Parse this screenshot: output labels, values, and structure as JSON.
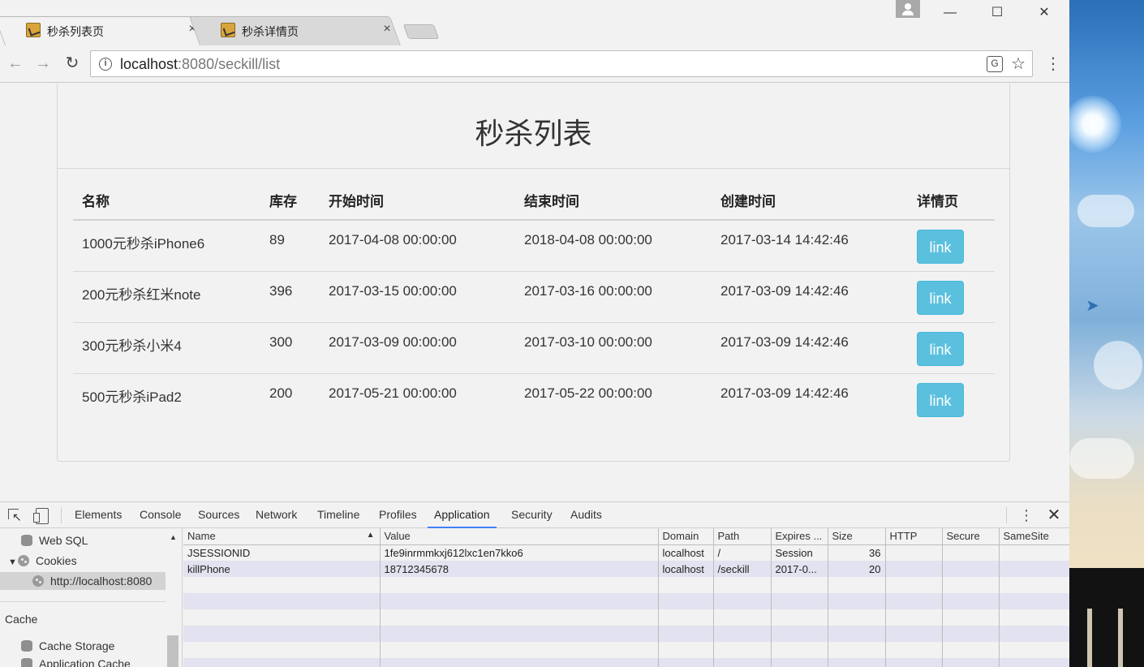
{
  "browser": {
    "tabs": [
      {
        "title": "秒杀列表页",
        "close": "×"
      },
      {
        "title": "秒杀详情页",
        "close": "×"
      }
    ],
    "window_controls": {
      "minimize": "—",
      "maximize": "☐",
      "close": "✕"
    },
    "url_host": "localhost",
    "url_rest": ":8080/seckill/list",
    "nav": {
      "back": "←",
      "forward": "→",
      "reload": "↻",
      "menu": "⋮"
    },
    "omnibox_icons": {
      "info": "i",
      "translate": "G",
      "star": "☆"
    }
  },
  "page": {
    "heading": "秒杀列表",
    "table": {
      "headers": [
        "名称",
        "库存",
        "开始时间",
        "结束时间",
        "创建时间",
        "详情页"
      ],
      "rows": [
        {
          "name": "1000元秒杀iPhone6",
          "stock": "89",
          "start": "2017-04-08 00:00:00",
          "end": "2018-04-08 00:00:00",
          "created": "2017-03-14 14:42:46",
          "action": "link"
        },
        {
          "name": "200元秒杀红米note",
          "stock": "396",
          "start": "2017-03-15 00:00:00",
          "end": "2017-03-16 00:00:00",
          "created": "2017-03-09 14:42:46",
          "action": "link"
        },
        {
          "name": "300元秒杀小米4",
          "stock": "300",
          "start": "2017-03-09 00:00:00",
          "end": "2017-03-10 00:00:00",
          "created": "2017-03-09 14:42:46",
          "action": "link"
        },
        {
          "name": "500元秒杀iPad2",
          "stock": "200",
          "start": "2017-05-21 00:00:00",
          "end": "2017-05-22 00:00:00",
          "created": "2017-03-09 14:42:46",
          "action": "link"
        }
      ]
    },
    "button_color": "#5bc0de"
  },
  "devtools": {
    "tabs": [
      "Elements",
      "Console",
      "Sources",
      "Network",
      "Timeline",
      "Profiles",
      "Application",
      "Security",
      "Audits"
    ],
    "active_tab": "Application",
    "kebab": "⋮",
    "close": "✕",
    "sidebar": {
      "web_sql": "Web SQL",
      "cookies": "Cookies",
      "cookie_origin": "http://localhost:8080",
      "cache_group": "Cache",
      "cache_storage": "Cache Storage",
      "application_cache": "Application Cache"
    },
    "cookie_columns": [
      "Name",
      "Value",
      "Domain",
      "Path",
      "Expires ...",
      "Size",
      "HTTP",
      "Secure",
      "SameSite"
    ],
    "cookies": [
      {
        "name": "JSESSIONID",
        "value": "1fe9inrmmkxj612lxc1en7kko6",
        "domain": "localhost",
        "path": "/",
        "expires": "Session",
        "size": "36",
        "http": "",
        "secure": "",
        "samesite": ""
      },
      {
        "name": "killPhone",
        "value": "18712345678",
        "domain": "localhost",
        "path": "/seckill",
        "expires": "2017-0...",
        "size": "20",
        "http": "",
        "secure": "",
        "samesite": ""
      }
    ]
  }
}
